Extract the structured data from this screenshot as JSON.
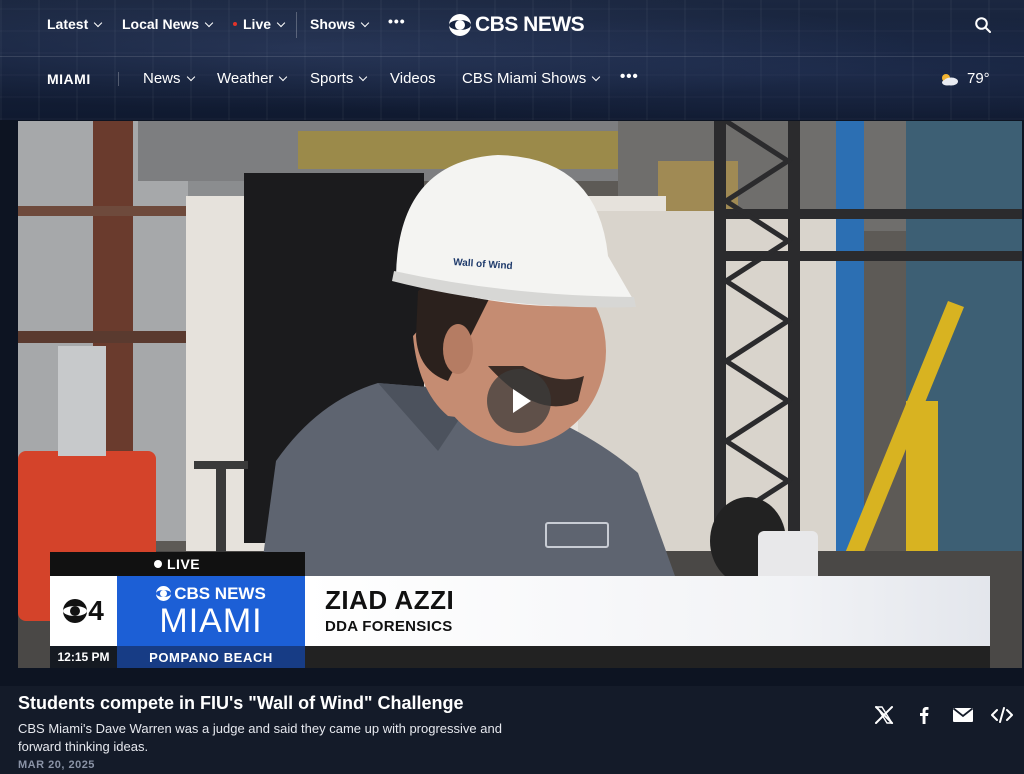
{
  "top_nav": {
    "items": [
      {
        "label": "Latest"
      },
      {
        "label": "Local News"
      },
      {
        "label": "Live"
      },
      {
        "label": "Shows"
      }
    ],
    "more": "•••",
    "logo": "CBS NEWS",
    "search_icon": "search-icon"
  },
  "sub_nav": {
    "station": "MIAMI",
    "items": [
      {
        "label": "News"
      },
      {
        "label": "Weather"
      },
      {
        "label": "Sports"
      },
      {
        "label": "Videos"
      },
      {
        "label": "CBS Miami Shows"
      }
    ],
    "more": "•••",
    "weather_icon": "partly-cloudy-icon",
    "temperature": "79°"
  },
  "video": {
    "hardhat_text": "Wall of Wind",
    "lower_third": {
      "live": "LIVE",
      "channel": "4",
      "brand_top": "CBS NEWS",
      "brand_city": "MIAMI",
      "name": "ZIAD AZZI",
      "title": "DDA FORENSICS",
      "time": "12:15 PM",
      "location": "POMPANO BEACH"
    }
  },
  "article": {
    "headline": "Students compete in FIU's \"Wall of Wind\" Challenge",
    "summary": "CBS Miami's Dave Warren was a judge and said they came up with progressive and forward thinking ideas.",
    "date": "MAR 20, 2025"
  },
  "share": [
    "x-icon",
    "facebook-icon",
    "email-icon",
    "embed-icon"
  ],
  "colors": {
    "accent_blue": "#1c5fd6",
    "live_red": "#e2332a",
    "header_bg": "#14203a"
  }
}
